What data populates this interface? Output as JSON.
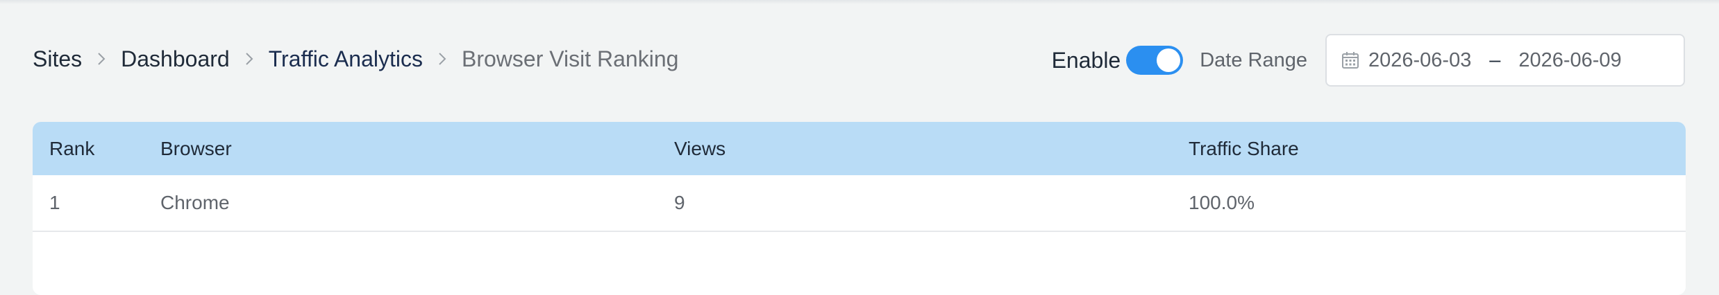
{
  "breadcrumb": {
    "items": [
      "Sites",
      "Dashboard",
      "Traffic Analytics",
      "Browser Visit Ranking"
    ]
  },
  "controls": {
    "enable_label": "Enable",
    "enable_on": true,
    "date_range_label": "Date Range",
    "date_start": "2026-06-03",
    "date_separator": "–",
    "date_end": "2026-06-09"
  },
  "table": {
    "headers": {
      "rank": "Rank",
      "browser": "Browser",
      "views": "Views",
      "share": "Traffic Share"
    },
    "rows": [
      {
        "rank": "1",
        "browser": "Chrome",
        "views": "9",
        "share": "100.0%"
      }
    ]
  },
  "colors": {
    "accent": "#2b8ff0",
    "header_bg": "#b9dcf6",
    "page_bg": "#f2f4f4"
  },
  "icons": {
    "breadcrumb_separator": "chevron-right-icon",
    "date_picker": "calendar-icon"
  }
}
